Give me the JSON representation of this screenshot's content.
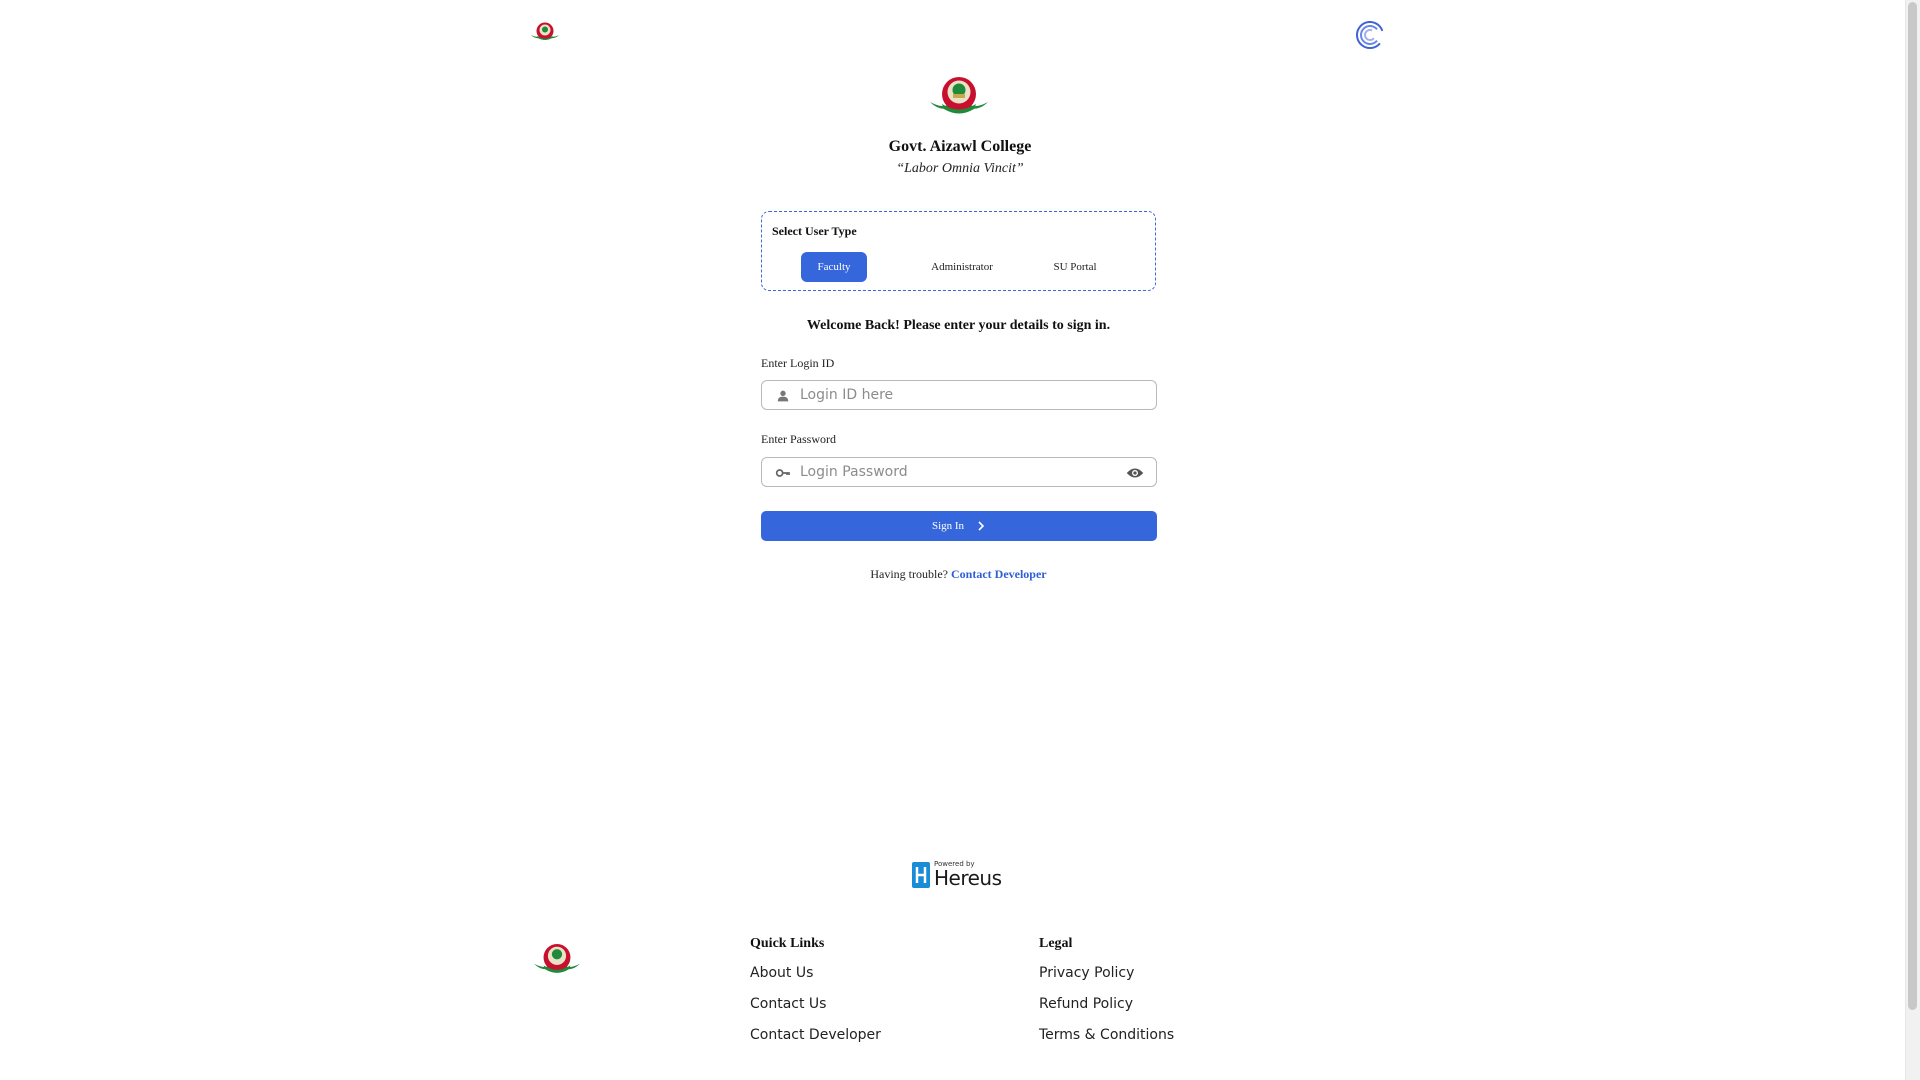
{
  "college": {
    "name": "Govt. Aizawl College",
    "motto": "“Labor Omnia Vincit”"
  },
  "user_type": {
    "label": "Select User Type",
    "options": [
      "Faculty",
      "Administrator",
      "SU Portal"
    ],
    "selected": "Faculty"
  },
  "login": {
    "welcome": "Welcome Back! Please enter your details to sign in.",
    "id_label": "Enter Login ID",
    "id_placeholder": "Login ID here",
    "password_label": "Enter Password",
    "password_placeholder": "Login Password",
    "sign_in": "Sign In",
    "trouble_text": "Having trouble?",
    "contact_developer": "Contact Developer"
  },
  "powered_by": {
    "small": "Powered by",
    "brand": "Hereus"
  },
  "footer": {
    "quick_links_heading": "Quick Links",
    "quick_links": [
      "About Us",
      "Contact Us",
      "Contact Developer"
    ],
    "legal_heading": "Legal",
    "legal_links": [
      "Privacy Policy",
      "Refund Policy",
      "Terms & Conditions"
    ]
  },
  "colors": {
    "primary": "#3566db",
    "link": "#2f5fd6",
    "emblem_red": "#c8102e",
    "emblem_green": "#1e8a3a"
  },
  "icons": {
    "login_field": "person-icon",
    "password_field": "key-icon",
    "password_toggle": "eye-icon",
    "sign_in_arrow": "chevron-right-icon",
    "top_right": "loader-logo-icon"
  }
}
